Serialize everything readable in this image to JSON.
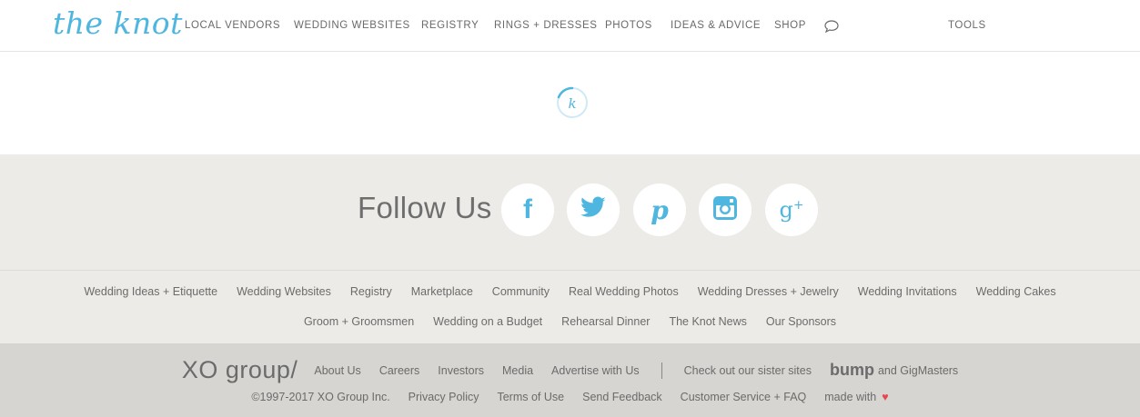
{
  "header": {
    "logo": "the knot",
    "nav": [
      "LOCAL VENDORS",
      "WEDDING WEBSITES",
      "REGISTRY",
      "RINGS + DRESSES",
      "PHOTOS",
      "IDEAS & ADVICE",
      "SHOP"
    ],
    "tools": "TOOLS",
    "chat_icon": "speech-bubble-icon"
  },
  "loader": {
    "glyph": "k",
    "icon": "loading-spinner-icon"
  },
  "follow": {
    "label": "Follow Us",
    "networks": [
      {
        "name": "facebook",
        "glyph": "f"
      },
      {
        "name": "twitter",
        "glyph": "bird"
      },
      {
        "name": "pinterest",
        "glyph": "p"
      },
      {
        "name": "instagram",
        "glyph": "camera"
      },
      {
        "name": "google-plus",
        "glyph": "g+"
      }
    ],
    "accent": "#4fb6df"
  },
  "footer_links": {
    "row1": [
      "Wedding Ideas + Etiquette",
      "Wedding Websites",
      "Registry",
      "Marketplace",
      "Community",
      "Real Wedding Photos",
      "Wedding Dresses + Jewelry",
      "Wedding Invitations",
      "Wedding Cakes"
    ],
    "row2": [
      "Groom + Groomsmen",
      "Wedding on a Budget",
      "Rehearsal Dinner",
      "The Knot News",
      "Our Sponsors"
    ]
  },
  "bottom": {
    "xo_logo": "XO group/",
    "corporate_links": [
      "About Us",
      "Careers",
      "Investors",
      "Media",
      "Advertise with Us"
    ],
    "sister_text": "Check out our sister sites",
    "bump_logo": "bump",
    "sister_tail": "and GigMasters",
    "copyright": "©1997-2017 XO Group Inc.",
    "legal_links": [
      "Privacy Policy",
      "Terms of Use",
      "Send Feedback",
      "Customer Service + FAQ"
    ],
    "made_with": "made with",
    "heart": "♥",
    "heart_color": "#e8474f"
  }
}
